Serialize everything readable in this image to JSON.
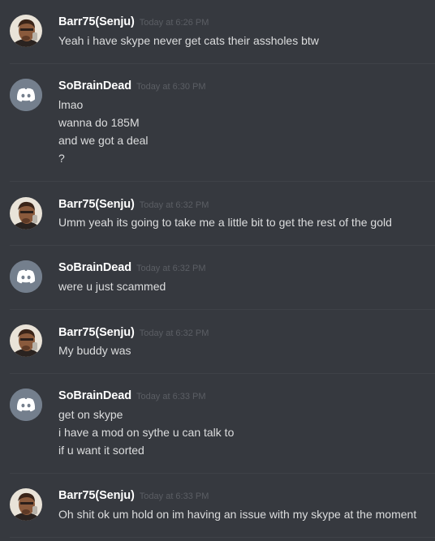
{
  "messages": [
    {
      "author": "Barr75(Senju)",
      "avatar": "user-photo-avatar",
      "timestamp": "Today at 6:26 PM",
      "lines": [
        "Yeah i have skype never get cats their assholes btw"
      ]
    },
    {
      "author": "SoBrainDead",
      "avatar": "discord-logo-avatar",
      "timestamp": "Today at 6:30 PM",
      "lines": [
        "lmao",
        "wanna do 185M",
        "and we got a deal",
        "?"
      ]
    },
    {
      "author": "Barr75(Senju)",
      "avatar": "user-photo-avatar",
      "timestamp": "Today at 6:32 PM",
      "lines": [
        "Umm yeah its going to take me a little bit to get the rest of the gold"
      ]
    },
    {
      "author": "SoBrainDead",
      "avatar": "discord-logo-avatar",
      "timestamp": "Today at 6:32 PM",
      "lines": [
        "were u just scammed"
      ]
    },
    {
      "author": "Barr75(Senju)",
      "avatar": "user-photo-avatar",
      "timestamp": "Today at 6:32 PM",
      "lines": [
        "My buddy was"
      ]
    },
    {
      "author": "SoBrainDead",
      "avatar": "discord-logo-avatar",
      "timestamp": "Today at 6:33 PM",
      "lines": [
        "get on skype",
        "i have a mod on sythe u can talk to",
        "if u want it sorted"
      ]
    },
    {
      "author": "Barr75(Senju)",
      "avatar": "user-photo-avatar",
      "timestamp": "Today at 6:33 PM",
      "lines": [
        "Oh shit ok um hold on im having an issue with my skype at the moment"
      ]
    }
  ],
  "colors": {
    "background": "#36393f",
    "username": "#ffffff",
    "timestamp": "#5b5e64",
    "message_text": "#dcddde",
    "discord_avatar_bg": "#747f8d",
    "divider": "#3f4248"
  }
}
